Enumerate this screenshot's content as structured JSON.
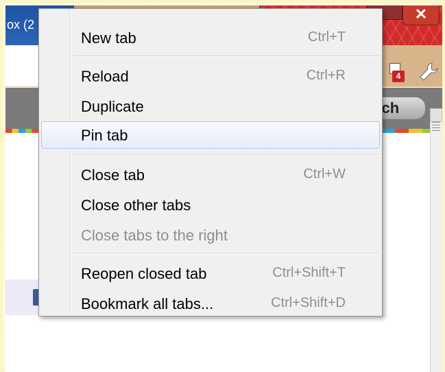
{
  "window": {
    "tab_title": "ox (2",
    "close_glyph": "✕",
    "badge_count": "4",
    "search_label": "rch"
  },
  "context_menu": {
    "items": [
      {
        "label": "New tab",
        "shortcut": "Ctrl+T",
        "disabled": false,
        "hover": false
      },
      {
        "label": "Reload",
        "shortcut": "Ctrl+R",
        "disabled": false,
        "hover": false
      },
      {
        "label": "Duplicate",
        "shortcut": "",
        "disabled": false,
        "hover": false
      },
      {
        "label": "Pin tab",
        "shortcut": "",
        "disabled": false,
        "hover": true
      },
      {
        "label": "Close tab",
        "shortcut": "Ctrl+W",
        "disabled": false,
        "hover": false
      },
      {
        "label": "Close other tabs",
        "shortcut": "",
        "disabled": false,
        "hover": false
      },
      {
        "label": "Close tabs to the right",
        "shortcut": "",
        "disabled": true,
        "hover": false
      },
      {
        "label": "Reopen closed tab",
        "shortcut": "Ctrl+Shift+T",
        "disabled": false,
        "hover": false
      },
      {
        "label": "Bookmark all tabs...",
        "shortcut": "Ctrl+Shift+D",
        "disabled": false,
        "hover": false
      }
    ]
  },
  "colors": {
    "menu_bg": "#f0f0f0",
    "hover_border": "#a8c7ec",
    "disabled_text": "#8e8e8e",
    "tabstrip_blue": "#2c64b6",
    "theme_red": "#d22a2a"
  },
  "icons": {
    "wrench": "wrench-icon",
    "extension": "extension-icon",
    "close": "close-icon",
    "scroll_up": "scroll-up-arrow-icon"
  }
}
